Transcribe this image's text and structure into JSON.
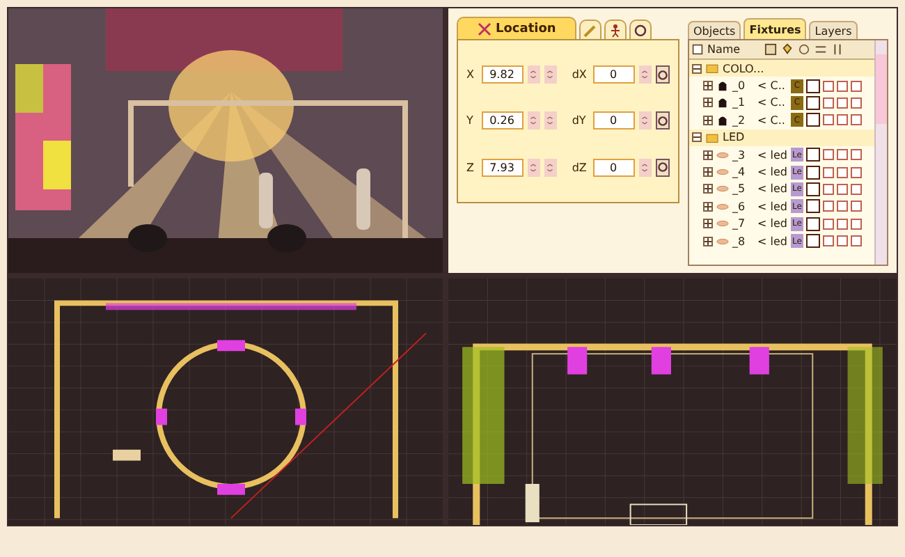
{
  "location_panel": {
    "tabs": [
      {
        "kind": "location",
        "label": "Location",
        "selected": true
      },
      {
        "kind": "pencil",
        "selected": false
      },
      {
        "kind": "figure",
        "selected": false
      },
      {
        "kind": "rotate",
        "selected": false
      }
    ],
    "rows": [
      {
        "axis": "X",
        "value": "9.82",
        "delta_label": "dX",
        "delta": "0"
      },
      {
        "axis": "Y",
        "value": "0.26",
        "delta_label": "dY",
        "delta": "0"
      },
      {
        "axis": "Z",
        "value": "7.93",
        "delta_label": "dZ",
        "delta": "0"
      }
    ]
  },
  "fixtures_panel": {
    "tabs": [
      {
        "label": "Objects",
        "selected": false
      },
      {
        "label": "Fixtures",
        "selected": true
      },
      {
        "label": "Layers",
        "selected": false
      }
    ],
    "name_column": "Name",
    "groups": [
      {
        "name": "COLO...",
        "expanded": true,
        "children": [
          {
            "kind": "moving-head",
            "name": "_0",
            "type": "< C..",
            "badge": "C",
            "color": "#8a6a12",
            "checks": [
              false,
              false,
              false,
              false
            ]
          },
          {
            "kind": "moving-head",
            "name": "_1",
            "type": "< C..",
            "badge": "C",
            "color": "#8a6a12",
            "checks": [
              false,
              false,
              false,
              false
            ]
          },
          {
            "kind": "moving-head",
            "name": "_2",
            "type": "< C..",
            "badge": "C",
            "color": "#8a6a12",
            "checks": [
              false,
              false,
              false,
              false
            ]
          }
        ]
      },
      {
        "name": "LED",
        "expanded": true,
        "children": [
          {
            "kind": "led-panel",
            "name": "_3",
            "type": "< led",
            "badge": "Le",
            "color": "#b89ad0",
            "checks": [
              false,
              false,
              false,
              false
            ]
          },
          {
            "kind": "led-panel",
            "name": "_4",
            "type": "< led",
            "badge": "Le",
            "color": "#b89ad0",
            "checks": [
              false,
              false,
              false,
              false
            ]
          },
          {
            "kind": "led-panel",
            "name": "_5",
            "type": "< led",
            "badge": "Le",
            "color": "#b89ad0",
            "checks": [
              false,
              false,
              false,
              false
            ]
          },
          {
            "kind": "led-panel",
            "name": "_6",
            "type": "< led",
            "badge": "Le",
            "color": "#b89ad0",
            "checks": [
              false,
              false,
              false,
              false
            ]
          },
          {
            "kind": "led-panel",
            "name": "_7",
            "type": "< led",
            "badge": "Le",
            "color": "#b89ad0",
            "checks": [
              false,
              false,
              false,
              false
            ]
          },
          {
            "kind": "led-panel",
            "name": "_8",
            "type": "< led",
            "badge": "Le",
            "color": "#b89ad0",
            "checks": [
              false,
              false,
              false,
              false
            ]
          }
        ]
      }
    ]
  },
  "viewports": [
    {
      "kind": "picture"
    },
    {
      "kind": "top-view"
    },
    {
      "kind": "front-view"
    }
  ]
}
